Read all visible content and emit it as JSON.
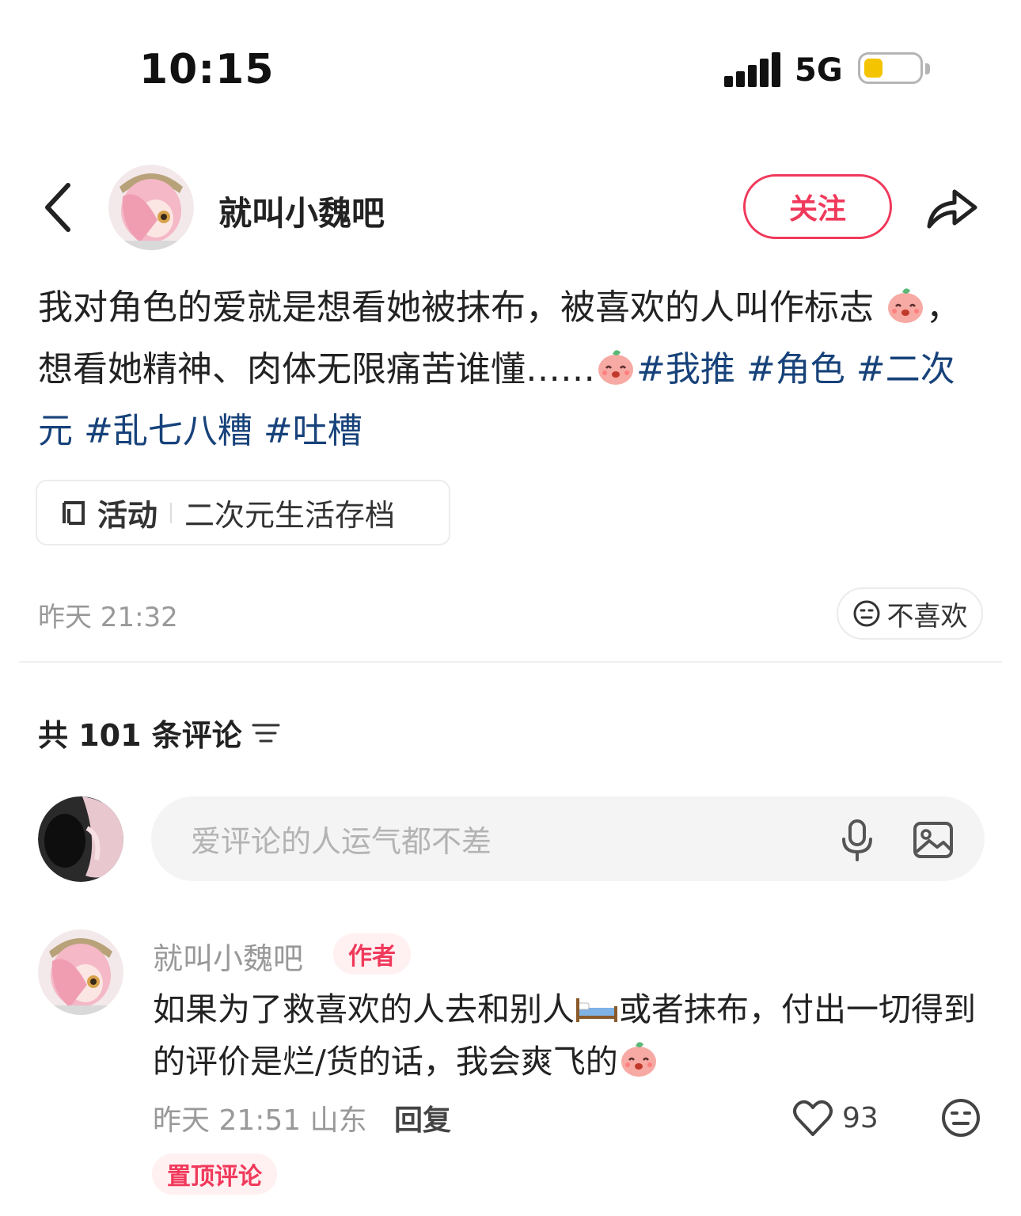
{
  "status_bar": {
    "time": "10:15",
    "network": "5G",
    "battery_level": 0.35,
    "battery_color": "#f5c400"
  },
  "header": {
    "author_name": "就叫小魏吧",
    "follow_label": "关注",
    "accent_color": "#f0395b"
  },
  "post": {
    "text_part1": "我对角色的爱就是想看她被抹布，被喜欢的人叫作标志",
    "text_part2": "，想看她精神、肉体无限痛苦谁懂……",
    "tags": [
      "#我推",
      "#角色",
      "#二次元",
      "#乱七八糟",
      "#吐槽"
    ],
    "tag_color": "#17427a",
    "activity_label": "活动",
    "activity_title": "二次元生活存档",
    "time": "昨天 21:32",
    "dislike_label": "不喜欢"
  },
  "comments": {
    "count_label": "共 101 条评论",
    "input_placeholder": "爱评论的人运气都不差",
    "items": [
      {
        "name": "就叫小魏吧",
        "badge": "作者",
        "text_part1": "如果为了救喜欢的人去和别人",
        "text_part2": "或者抹布，付出一切得到的评价是烂/货的话，我会爽飞的",
        "meta": "昨天 21:51 山东",
        "reply_label": "回复",
        "likes": "93",
        "pin_label": "置顶评论"
      }
    ]
  }
}
